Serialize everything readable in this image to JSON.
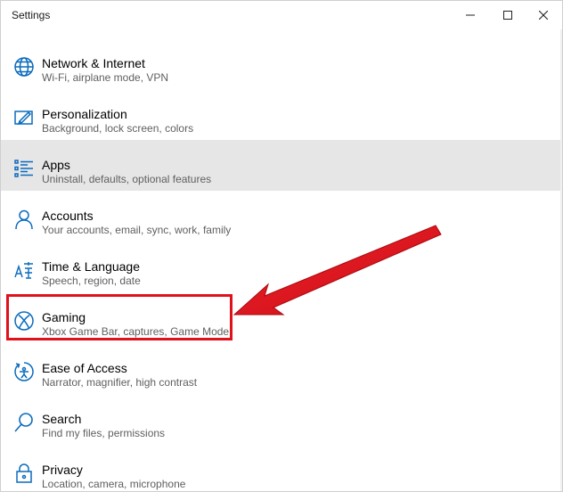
{
  "window": {
    "title": "Settings",
    "controls": {
      "minimize": "minimize-icon",
      "maximize": "maximize-icon",
      "close": "close-icon"
    }
  },
  "items": [
    {
      "label": "Network & Internet",
      "desc": "Wi-Fi, airplane mode, VPN",
      "icon": "globe-icon",
      "selected": false
    },
    {
      "label": "Personalization",
      "desc": "Background, lock screen, colors",
      "icon": "paint-brush-icon",
      "selected": false
    },
    {
      "label": "Apps",
      "desc": "Uninstall, defaults, optional features",
      "icon": "apps-list-icon",
      "selected": true
    },
    {
      "label": "Accounts",
      "desc": "Your accounts, email, sync, work, family",
      "icon": "person-icon",
      "selected": false
    },
    {
      "label": "Time & Language",
      "desc": "Speech, region, date",
      "icon": "time-language-icon",
      "selected": false
    },
    {
      "label": "Gaming",
      "desc": "Xbox Game Bar, captures, Game Mode",
      "icon": "xbox-icon",
      "selected": false
    },
    {
      "label": "Ease of Access",
      "desc": "Narrator, magnifier, high contrast",
      "icon": "ease-of-access-icon",
      "selected": false
    },
    {
      "label": "Search",
      "desc": "Find my files, permissions",
      "icon": "search-icon",
      "selected": false
    },
    {
      "label": "Privacy",
      "desc": "Location, camera, microphone",
      "icon": "lock-icon",
      "selected": false
    }
  ],
  "colors": {
    "accent": "#0a6bbd",
    "highlight": "#e0111b",
    "selected_bg": "#e6e6e6"
  }
}
